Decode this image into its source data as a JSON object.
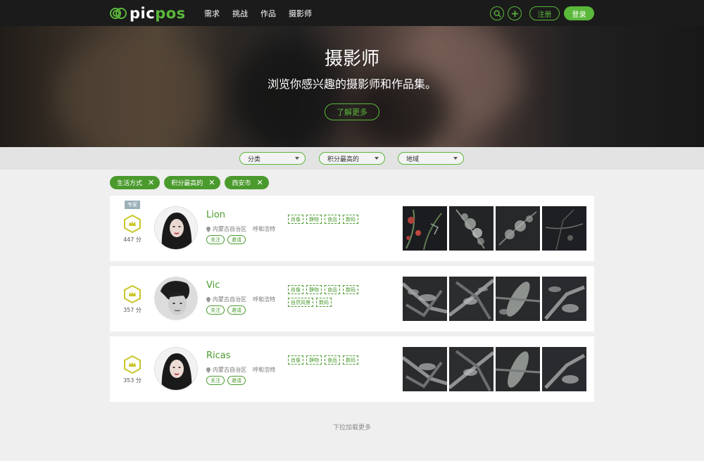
{
  "brand": {
    "logo_white": "pic",
    "logo_green": "pos",
    "accent": "#5ab83a"
  },
  "nav": {
    "links": [
      "需求",
      "挑战",
      "作品",
      "摄影师"
    ]
  },
  "header_actions": {
    "search_icon": "search-icon",
    "add_icon": "plus-icon",
    "register": "注册",
    "login": "登录"
  },
  "hero": {
    "title": "摄影师",
    "subtitle": "浏览你感兴趣的摄影师和作品集。",
    "button": "了解更多"
  },
  "filters": [
    {
      "label": "分类"
    },
    {
      "label": "积分最高的"
    },
    {
      "label": "地域"
    }
  ],
  "active_chips": [
    {
      "label": "生活方式",
      "close": "✕"
    },
    {
      "label": "积分最高的",
      "close": "✕"
    },
    {
      "label": "西安市",
      "close": "✕"
    }
  ],
  "photographers": [
    {
      "badge": "专家",
      "score": "447 分",
      "name": "Lion",
      "region": "内蒙古自治区",
      "city": "呼和浩特",
      "follow": "关注",
      "invite": "邀请",
      "tags": [
        "肖像",
        "静物",
        "食品",
        "数码"
      ]
    },
    {
      "badge": "",
      "score": "357 分",
      "name": "Vic",
      "region": "内蒙古自治区",
      "city": "呼和浩特",
      "follow": "关注",
      "invite": "邀请",
      "tags": [
        "肖像",
        "静物",
        "食品",
        "数码",
        "自然风景",
        "数码"
      ]
    },
    {
      "badge": "",
      "score": "353 分",
      "name": "Ricas",
      "region": "内蒙古自治区",
      "city": "呼和浩特",
      "follow": "关注",
      "invite": "邀请",
      "tags": [
        "肖像",
        "静物",
        "食品",
        "数码"
      ]
    }
  ],
  "load_more": "下拉加载更多"
}
